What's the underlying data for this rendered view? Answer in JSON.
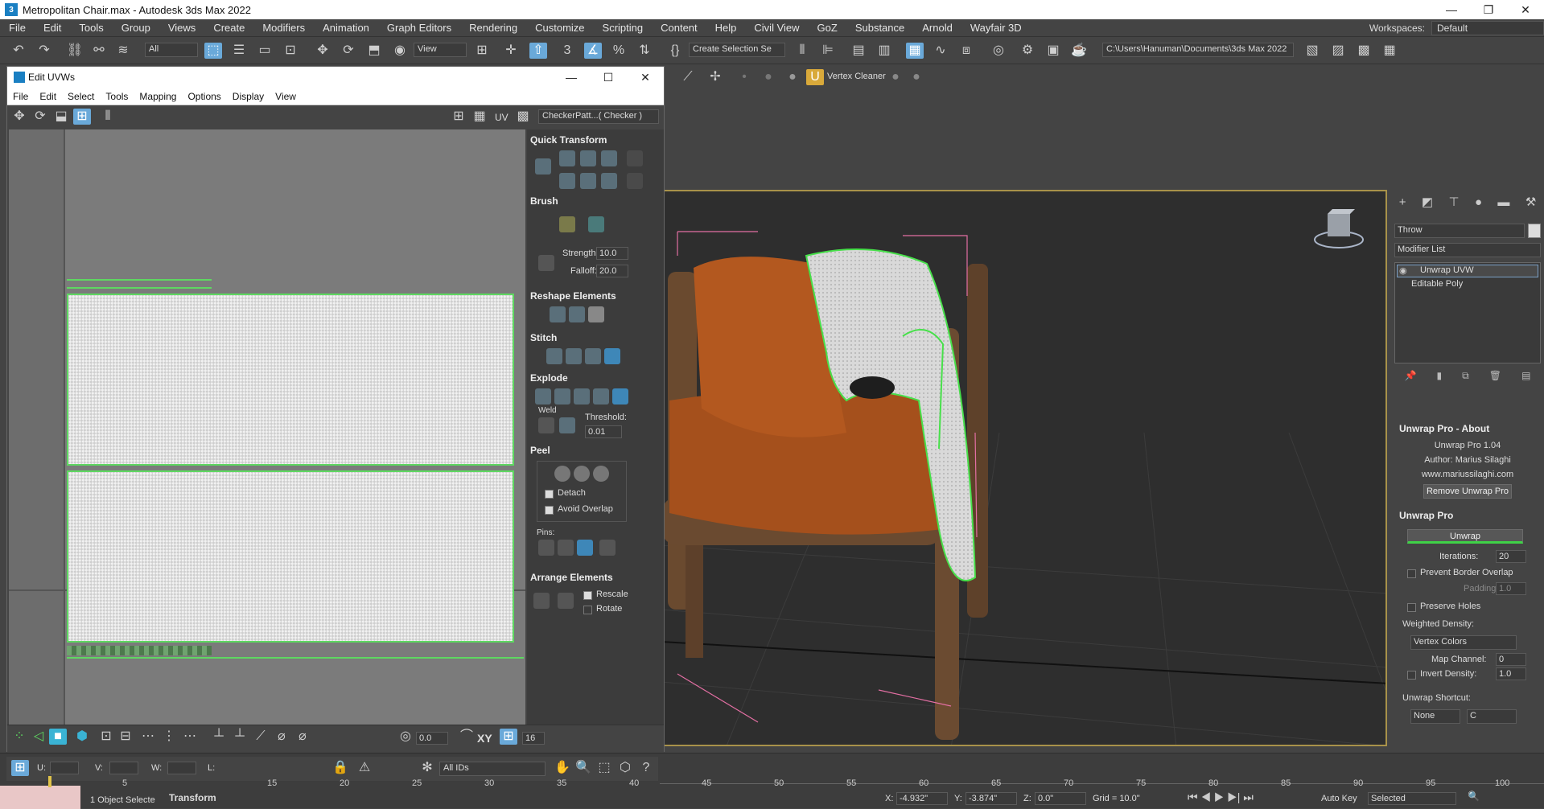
{
  "app": {
    "title": "Metropolitan Chair.max - Autodesk 3ds Max 2022",
    "min": "—",
    "max": "❐",
    "close": "✕"
  },
  "menu": [
    "File",
    "Edit",
    "Tools",
    "Group",
    "Views",
    "Create",
    "Modifiers",
    "Animation",
    "Graph Editors",
    "Rendering",
    "Customize",
    "Scripting",
    "Content",
    "Help",
    "Civil View",
    "GoZ",
    "Substance",
    "Arnold",
    "Wayfair 3D"
  ],
  "workspace": {
    "label": "Workspaces:",
    "value": "Default"
  },
  "toolbar": {
    "filter": "All",
    "ref_coord": "View",
    "selection_set": "Create Selection Se",
    "path": "C:\\Users\\Hanuman\\Documents\\3ds Max 2022",
    "vertex_cleaner": "Vertex Cleaner"
  },
  "uvw": {
    "title": "Edit UVWs",
    "menu": [
      "File",
      "Edit",
      "Select",
      "Tools",
      "Mapping",
      "Options",
      "Display",
      "View"
    ],
    "uv_label": "UV",
    "checker": "CheckerPatt...( Checker )",
    "sections": {
      "quick_transform": "Quick Transform",
      "brush": "Brush",
      "strength_label": "Strength:",
      "strength": "10.0",
      "falloff_label": "Falloff:",
      "falloff": "20.0",
      "reshape": "Reshape Elements",
      "stitch": "Stitch",
      "explode": "Explode",
      "weld": "Weld",
      "threshold_label": "Threshold:",
      "threshold": "0.01",
      "peel": "Peel",
      "detach": "Detach",
      "avoid_overlap": "Avoid Overlap",
      "pins": "Pins:",
      "arrange": "Arrange Elements",
      "rescale": "Rescale",
      "rotate": "Rotate"
    },
    "bottom": {
      "angle": "0.0",
      "xy": "XY",
      "pixels": "16",
      "u": "U:",
      "v": "V:",
      "w": "W:",
      "l": "L:",
      "ids": "All IDs"
    }
  },
  "cmd": {
    "name": "Throw",
    "modifier_list": "Modifier List",
    "stack": [
      "Unwrap UVW",
      "Editable Poly"
    ],
    "about_title": "Unwrap Pro - About",
    "about_version": "Unwrap Pro 1.04",
    "about_author": "Author: Marius Silaghi",
    "about_site": "www.mariussilaghi.com",
    "remove_btn": "Remove Unwrap Pro",
    "pro_title": "Unwrap Pro",
    "unwrap_btn": "Unwrap",
    "iterations_label": "Iterations:",
    "iterations": "20",
    "prevent_overlap": "Prevent Border Overlap",
    "padding_label": "Padding:",
    "padding": "1.0",
    "preserve_holes": "Preserve Holes",
    "weighted_density": "Weighted Density:",
    "density_type": "Vertex Colors",
    "map_channel_label": "Map Channel:",
    "map_channel": "0",
    "invert_label": "Invert Density:",
    "invert": "1.0",
    "shortcut_label": "Unwrap Shortcut:",
    "shortcut_mod": "None",
    "shortcut_key": "C"
  },
  "status": {
    "selected": "1 Object Selecte",
    "transform": "Transform",
    "x_label": "X:",
    "x": "-4.932\"",
    "y_label": "Y:",
    "y": "-3.874\"",
    "z_label": "Z:",
    "z": "0.0\"",
    "grid": "Grid = 10.0\"",
    "autokey": "Auto Key",
    "key_mode": "Selected",
    "ticks": [
      "20",
      "25",
      "30",
      "35",
      "40",
      "45",
      "50",
      "55",
      "60",
      "65",
      "70",
      "75",
      "80",
      "85",
      "90",
      "95",
      "100"
    ]
  }
}
